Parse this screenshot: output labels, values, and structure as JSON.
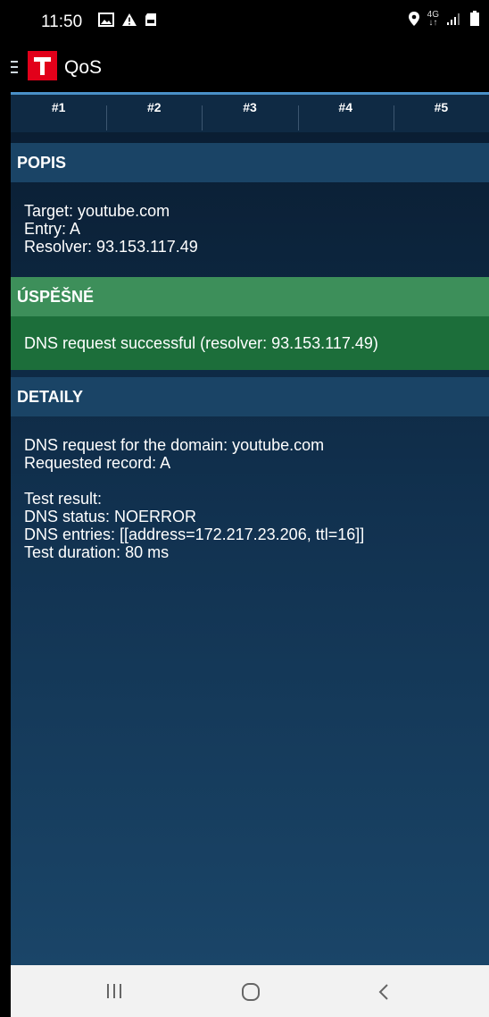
{
  "status_bar": {
    "time": "11:50",
    "left_icons": [
      "gallery-icon",
      "warning-icon",
      "sd-card-icon"
    ],
    "network_label_top": "4G",
    "network_label_bottom": "↓↑",
    "right_icons": [
      "location-icon",
      "signal-icon",
      "battery-icon"
    ]
  },
  "app_bar": {
    "title": "QoS",
    "brand_color": "#e2001a"
  },
  "tabs": [
    {
      "label": "#1"
    },
    {
      "label": "#2"
    },
    {
      "label": "#3"
    },
    {
      "label": "#4"
    },
    {
      "label": "#5"
    }
  ],
  "popis": {
    "header": "POPIS",
    "lines": [
      "Target: youtube.com",
      "Entry: A",
      "Resolver: 93.153.117.49"
    ]
  },
  "result": {
    "header": "ÚSPĚŠNÉ",
    "message": "DNS request successful (resolver: 93.153.117.49)",
    "header_color": "#3d8f5a",
    "body_color": "#1c6e3a"
  },
  "details": {
    "header": "DETAILY",
    "lines_a": [
      "DNS request for the domain: youtube.com",
      "Requested record: A"
    ],
    "lines_b": [
      "Test result:",
      "DNS status: NOERROR",
      "DNS entries: [[address=172.217.23.206, ttl=16]]",
      "Test duration: 80 ms"
    ]
  },
  "nav_bar": {
    "buttons": [
      "recent-apps-icon",
      "home-icon",
      "back-icon"
    ]
  }
}
